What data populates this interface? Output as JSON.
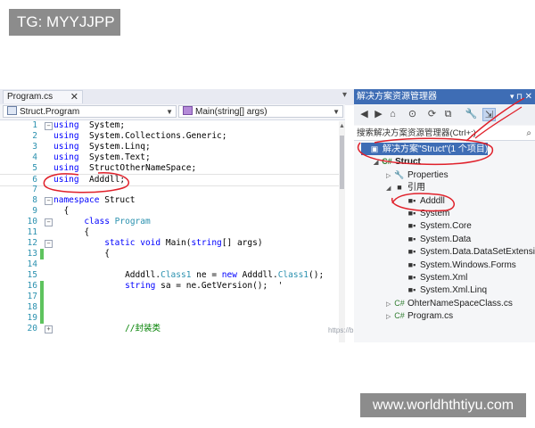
{
  "watermarks": {
    "top": "TG: MYYJJPP",
    "bottom": "www.worldhthtiyu.com",
    "csdn": "https://blog.csdn.net/shengmingxiajiyuxueshi"
  },
  "editor": {
    "tab_label": "Program.cs",
    "close_glyph": "✕",
    "overflow_glyph": "▾",
    "nav_left": "Struct.Program",
    "nav_right": "Main(string[] args)",
    "lines": [
      {
        "n": "1",
        "fold": "−",
        "change": "",
        "code": [
          [
            "kw",
            "using"
          ],
          [
            "",
            "  System;"
          ]
        ]
      },
      {
        "n": "2",
        "fold": "",
        "change": "",
        "code": [
          [
            "kw",
            "using"
          ],
          [
            "",
            "  System.Collections.Generic;"
          ]
        ]
      },
      {
        "n": "3",
        "fold": "",
        "change": "",
        "code": [
          [
            "kw",
            "using"
          ],
          [
            "",
            "  System.Linq;"
          ]
        ]
      },
      {
        "n": "4",
        "fold": "",
        "change": "",
        "code": [
          [
            "kw",
            "using"
          ],
          [
            "",
            "  System.Text;"
          ]
        ]
      },
      {
        "n": "5",
        "fold": "",
        "change": "",
        "code": [
          [
            "kw",
            "using"
          ],
          [
            "",
            "  StructOtherNameSpace;"
          ]
        ]
      },
      {
        "n": "6",
        "fold": "",
        "change": "",
        "code": [
          [
            "kw",
            "using"
          ],
          [
            "",
            "  Adddll;"
          ]
        ]
      },
      {
        "n": "7",
        "fold": "",
        "change": "",
        "code": [
          [
            "",
            ""
          ]
        ]
      },
      {
        "n": "8",
        "fold": "−",
        "change": "",
        "code": [
          [
            "kw",
            "namespace"
          ],
          [
            "",
            " Struct"
          ]
        ]
      },
      {
        "n": "9",
        "fold": "",
        "change": "",
        "code": [
          [
            "",
            "  {"
          ]
        ]
      },
      {
        "n": "10",
        "fold": "−",
        "change": "",
        "code": [
          [
            "",
            "      "
          ],
          [
            "kw",
            "class"
          ],
          [
            "",
            ""
          ],
          [
            "ty",
            " Program"
          ]
        ]
      },
      {
        "n": "11",
        "fold": "",
        "change": "",
        "code": [
          [
            "",
            "      {"
          ]
        ]
      },
      {
        "n": "12",
        "fold": "−",
        "change": "",
        "code": [
          [
            "",
            "          "
          ],
          [
            "kw",
            "static void"
          ],
          [
            "",
            " Main("
          ],
          [
            "kw",
            "string"
          ],
          [
            "",
            "[] args)"
          ]
        ]
      },
      {
        "n": "13",
        "fold": "",
        "change": "green",
        "code": [
          [
            "",
            "          {"
          ]
        ]
      },
      {
        "n": "14",
        "fold": "",
        "change": "",
        "code": [
          [
            "",
            ""
          ]
        ]
      },
      {
        "n": "15",
        "fold": "",
        "change": "",
        "code": [
          [
            "",
            "              Adddll."
          ],
          [
            "ty",
            "Class1"
          ],
          [
            "",
            " ne = "
          ],
          [
            "kw",
            "new"
          ],
          [
            "",
            " Adddll."
          ],
          [
            "ty",
            "Class1"
          ],
          [
            "",
            "();"
          ]
        ]
      },
      {
        "n": "16",
        "fold": "",
        "change": "green",
        "code": [
          [
            "",
            "              "
          ],
          [
            "kw",
            "string"
          ],
          [
            "",
            " sa = ne.GetVersion();  '"
          ]
        ]
      },
      {
        "n": "17",
        "fold": "",
        "change": "green",
        "code": [
          [
            "",
            ""
          ]
        ]
      },
      {
        "n": "18",
        "fold": "",
        "change": "green",
        "code": [
          [
            "",
            ""
          ]
        ]
      },
      {
        "n": "19",
        "fold": "",
        "change": "green",
        "code": [
          [
            "",
            ""
          ]
        ]
      },
      {
        "n": "20",
        "fold": "+",
        "change": "",
        "code": [
          [
            "",
            "              "
          ],
          [
            "cm",
            "//封装类"
          ]
        ]
      }
    ]
  },
  "solution": {
    "title": "解决方案资源管理器",
    "pin": "▾ ⊓",
    "close": "✕",
    "search_placeholder": "搜索解决方案资源管理器(Ctrl+;)",
    "toolbar_icons": [
      "back-icon",
      "forward-icon",
      "home-icon",
      "history-icon",
      "sync-icon",
      "collapse-icon",
      "properties-icon",
      "preview-icon"
    ],
    "tree": [
      {
        "label": "解决方案\"Struct\"(1 个项目)",
        "indent": 0,
        "expander": "",
        "icon": "solution-icon",
        "glyph": "▣",
        "selected": true,
        "bold": false
      },
      {
        "label": "Struct",
        "indent": 1,
        "expander": "◢",
        "icon": "csharp-project-icon",
        "glyph": "C#",
        "selected": false,
        "bold": true
      },
      {
        "label": "Properties",
        "indent": 2,
        "expander": "▷",
        "icon": "wrench-icon",
        "glyph": "🔧",
        "selected": false,
        "bold": false
      },
      {
        "label": "引用",
        "indent": 2,
        "expander": "◢",
        "icon": "references-icon",
        "glyph": "■",
        "selected": false,
        "bold": false
      },
      {
        "label": "Adddll",
        "indent": 3,
        "expander": "",
        "icon": "reference-icon",
        "glyph": "■▪",
        "selected": false,
        "bold": false
      },
      {
        "label": "System",
        "indent": 3,
        "expander": "",
        "icon": "reference-icon",
        "glyph": "■▪",
        "selected": false,
        "bold": false
      },
      {
        "label": "System.Core",
        "indent": 3,
        "expander": "",
        "icon": "reference-icon",
        "glyph": "■▪",
        "selected": false,
        "bold": false
      },
      {
        "label": "System.Data",
        "indent": 3,
        "expander": "",
        "icon": "reference-icon",
        "glyph": "■▪",
        "selected": false,
        "bold": false
      },
      {
        "label": "System.Data.DataSetExtensions",
        "indent": 3,
        "expander": "",
        "icon": "reference-icon",
        "glyph": "■▪",
        "selected": false,
        "bold": false
      },
      {
        "label": "System.Windows.Forms",
        "indent": 3,
        "expander": "",
        "icon": "reference-icon",
        "glyph": "■▪",
        "selected": false,
        "bold": false
      },
      {
        "label": "System.Xml",
        "indent": 3,
        "expander": "",
        "icon": "reference-icon",
        "glyph": "■▪",
        "selected": false,
        "bold": false
      },
      {
        "label": "System.Xml.Linq",
        "indent": 3,
        "expander": "",
        "icon": "reference-icon",
        "glyph": "■▪",
        "selected": false,
        "bold": false
      },
      {
        "label": "OhterNameSpaceClass.cs",
        "indent": 2,
        "expander": "▷",
        "icon": "csharp-file-icon",
        "glyph": "C#",
        "selected": false,
        "bold": false
      },
      {
        "label": "Program.cs",
        "indent": 2,
        "expander": "▷",
        "icon": "csharp-file-icon",
        "glyph": "C#",
        "selected": false,
        "bold": false
      }
    ]
  },
  "colors": {
    "accent": "#3e6db5",
    "annotation": "#e0202a"
  }
}
